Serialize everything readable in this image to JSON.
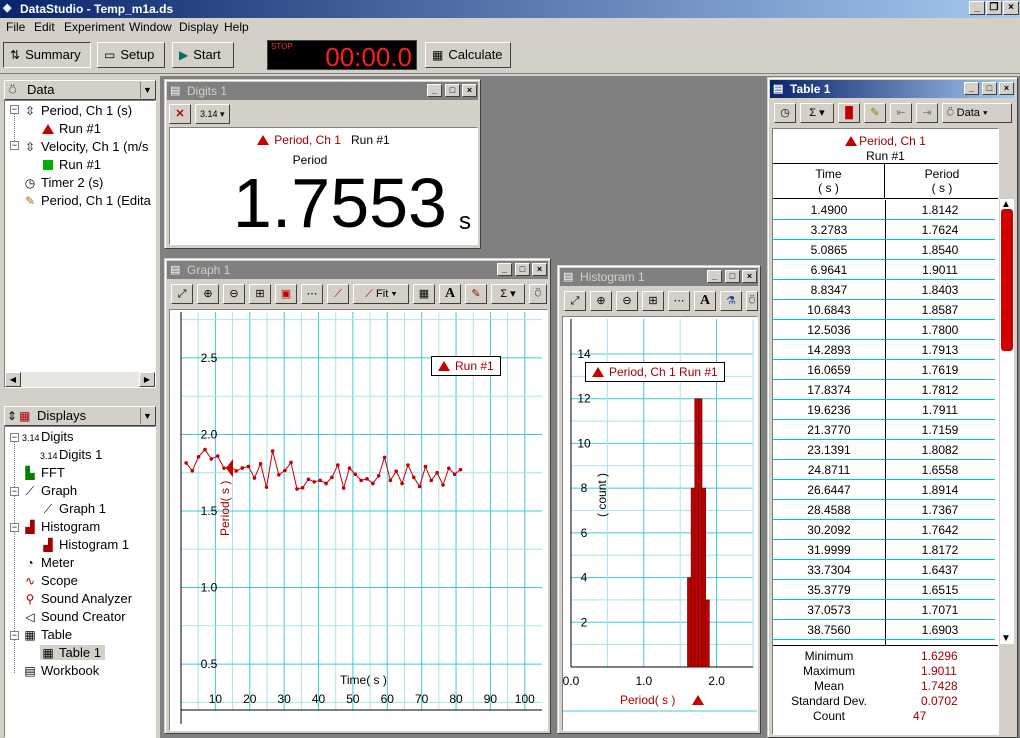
{
  "app": {
    "title": "DataStudio - Temp_m1a.ds"
  },
  "menu": [
    "File",
    "Edit",
    "Experiment",
    "Window",
    "Display",
    "Help"
  ],
  "toolbar": {
    "summary": "Summary",
    "setup": "Setup",
    "start": "Start",
    "timer_label": "STOP",
    "timer_value": "00:00.0",
    "calculate": "Calculate"
  },
  "data_panel": {
    "header": "Data",
    "items": [
      {
        "label": "Period, Ch 1 (s)",
        "icon": "period-sensor-icon"
      },
      {
        "label": "Run #1",
        "icon": "red-triangle-icon"
      },
      {
        "label": "Velocity, Ch 1 (m/s",
        "icon": "velocity-sensor-icon"
      },
      {
        "label": "Run #1",
        "icon": "green-square-icon"
      },
      {
        "label": "Timer 2 (s)",
        "icon": "stopwatch-icon"
      },
      {
        "label": "Period, Ch 1 (Edita",
        "icon": "pencil-icon"
      }
    ]
  },
  "displays_panel": {
    "header": "Displays",
    "items": [
      {
        "label": "Digits",
        "icon": "digits-icon"
      },
      {
        "label": "Digits 1",
        "icon": "digits-icon"
      },
      {
        "label": "FFT",
        "icon": "fft-icon"
      },
      {
        "label": "Graph",
        "icon": "graph-icon"
      },
      {
        "label": "Graph 1",
        "icon": "graph-icon"
      },
      {
        "label": "Histogram",
        "icon": "histogram-icon"
      },
      {
        "label": "Histogram 1",
        "icon": "histogram-icon"
      },
      {
        "label": "Meter",
        "icon": "meter-icon"
      },
      {
        "label": "Scope",
        "icon": "scope-icon"
      },
      {
        "label": "Sound Analyzer",
        "icon": "sound-analyzer-icon"
      },
      {
        "label": "Sound Creator",
        "icon": "speaker-icon"
      },
      {
        "label": "Table",
        "icon": "table-icon"
      },
      {
        "label": "Table 1",
        "icon": "table-icon"
      },
      {
        "label": "Workbook",
        "icon": "workbook-icon"
      }
    ]
  },
  "digits": {
    "title": "Digits 1",
    "source": "Period, Ch 1",
    "run": "Run #1",
    "label": "Period",
    "value": "1.7553",
    "unit": "s"
  },
  "graph": {
    "title": "Graph 1",
    "fit_label": "Fit",
    "legend": "Run #1",
    "ylabel": "Period( s )",
    "xlabel": "Time( s )",
    "xticks": [
      "10",
      "20",
      "30",
      "40",
      "50",
      "60",
      "70",
      "80",
      "90",
      "100"
    ],
    "yticks": [
      "2.5",
      "2.0",
      "1.5",
      "1.0",
      "0.5"
    ]
  },
  "histogram": {
    "title": "Histogram 1",
    "legend": "Period, Ch 1 Run #1",
    "ylabel": "( count )",
    "xlabel": "Period( s )",
    "yticks": [
      "14",
      "12",
      "10",
      "8",
      "6",
      "4",
      "2"
    ],
    "xticks": [
      "0.0",
      "1.0",
      "2.0"
    ]
  },
  "table": {
    "title": "Table 1",
    "data_button": "Data",
    "source": "Period, Ch 1",
    "run": "Run #1",
    "col1": "Time",
    "col1_unit": "( s )",
    "col2": "Period",
    "col2_unit": "( s )",
    "rows": [
      [
        "1.4900",
        "1.8142"
      ],
      [
        "3.2783",
        "1.7624"
      ],
      [
        "5.0865",
        "1.8540"
      ],
      [
        "6.9641",
        "1.9011"
      ],
      [
        "8.8347",
        "1.8403"
      ],
      [
        "10.6843",
        "1.8587"
      ],
      [
        "12.5036",
        "1.7800"
      ],
      [
        "14.2893",
        "1.7913"
      ],
      [
        "16.0659",
        "1.7619"
      ],
      [
        "17.8374",
        "1.7812"
      ],
      [
        "19.6236",
        "1.7911"
      ],
      [
        "21.3770",
        "1.7159"
      ],
      [
        "23.1391",
        "1.8082"
      ],
      [
        "24.8711",
        "1.6558"
      ],
      [
        "26.6447",
        "1.8914"
      ],
      [
        "28.4588",
        "1.7367"
      ],
      [
        "30.2092",
        "1.7642"
      ],
      [
        "31.9999",
        "1.8172"
      ],
      [
        "33.7304",
        "1.6437"
      ],
      [
        "35.3779",
        "1.6515"
      ],
      [
        "37.0573",
        "1.7071"
      ],
      [
        "38.7560",
        "1.6903"
      ]
    ],
    "stats": [
      {
        "label": "Minimum",
        "value": "1.6296"
      },
      {
        "label": "Maximum",
        "value": "1.9011"
      },
      {
        "label": "Mean",
        "value": "1.7428"
      },
      {
        "label": "Standard Dev.",
        "value": "0.0702"
      },
      {
        "label": "Count",
        "value": "47"
      }
    ]
  },
  "chart_data": [
    {
      "type": "line",
      "xlabel": "Time( s )",
      "ylabel": "Period( s )",
      "xlim": [
        0,
        105
      ],
      "ylim": [
        0.2,
        2.8
      ],
      "grid": true,
      "legend_position": "top-right",
      "series": [
        {
          "name": "Run #1",
          "color": "#c40000",
          "x": [
            1.49,
            3.28,
            5.09,
            6.96,
            8.83,
            10.68,
            12.5,
            14.29,
            16.07,
            17.84,
            19.62,
            21.38,
            23.14,
            24.87,
            26.64,
            28.46,
            30.21,
            32.0,
            33.73,
            35.38,
            37.06,
            38.76,
            40.5,
            42.2,
            43.9,
            45.6,
            47.3,
            49.0,
            50.7,
            52.4,
            54.1,
            55.8,
            57.5,
            59.2,
            60.9,
            62.6,
            64.3,
            66.0,
            67.7,
            69.4,
            71.1,
            72.8,
            74.5,
            76.2,
            77.9,
            79.6,
            81.3
          ],
          "y": [
            1.8142,
            1.7624,
            1.854,
            1.9011,
            1.8403,
            1.8587,
            1.78,
            1.7913,
            1.7619,
            1.7812,
            1.7911,
            1.7159,
            1.8082,
            1.6558,
            1.8914,
            1.7367,
            1.7642,
            1.8172,
            1.6437,
            1.6515,
            1.7071,
            1.6903,
            1.7,
            1.68,
            1.72,
            1.8,
            1.65,
            1.78,
            1.74,
            1.7,
            1.71,
            1.68,
            1.73,
            1.85,
            1.7,
            1.76,
            1.68,
            1.8,
            1.72,
            1.66,
            1.79,
            1.7,
            1.75,
            1.67,
            1.78,
            1.74,
            1.77
          ]
        }
      ]
    },
    {
      "type": "bar",
      "xlabel": "Period( s )",
      "ylabel": "( count )",
      "xlim": [
        0,
        2.5
      ],
      "ylim": [
        0,
        14
      ],
      "grid": true,
      "legend_position": "top",
      "series": [
        {
          "name": "Period, Ch 1 Run #1",
          "color": "#c40000",
          "bins": [
            1.625,
            1.675,
            1.725,
            1.775,
            1.825,
            1.875
          ],
          "values": [
            4,
            8,
            12,
            12,
            8,
            3
          ]
        }
      ]
    }
  ]
}
